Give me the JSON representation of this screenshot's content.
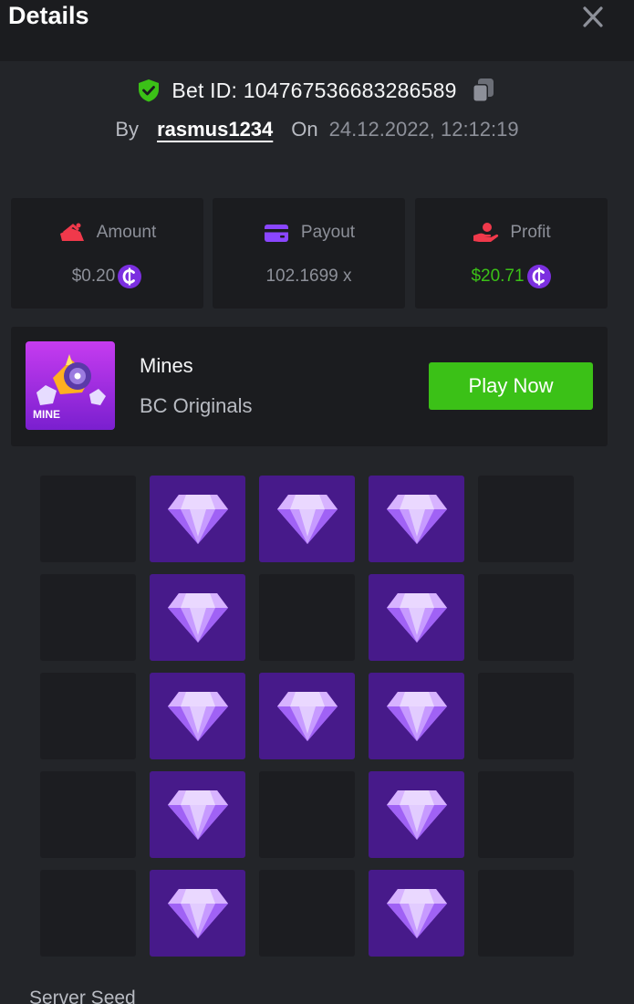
{
  "header": {
    "title": "Details",
    "close_icon": "close-icon"
  },
  "bet": {
    "bet_id_text": "Bet ID: 104767536683286589",
    "by_label": "By",
    "username": "rasmus1234",
    "on_label": "On",
    "datetime": "24.12.2022, 12:12:19",
    "icons": [
      "shield-check-icon",
      "copy-icon"
    ]
  },
  "stats": {
    "amount": {
      "label": "Amount",
      "value": "$0.20",
      "icon": "amount-icon",
      "coin_icon": "bc-coin-icon"
    },
    "payout": {
      "label": "Payout",
      "value": "102.1699 x",
      "icon": "wallet-card-icon"
    },
    "profit": {
      "label": "Profit",
      "value": "$20.71",
      "icon": "profit-hand-icon",
      "coin_icon": "bc-coin-icon"
    }
  },
  "game": {
    "thumbnail_text": "MINE",
    "name": "Mines",
    "provider": "BC Originals",
    "play_label": "Play Now"
  },
  "board": {
    "rows": 5,
    "cols": 5,
    "cells": [
      [
        "empty",
        "gem",
        "gem",
        "gem",
        "empty"
      ],
      [
        "empty",
        "gem",
        "empty",
        "gem",
        "empty"
      ],
      [
        "empty",
        "gem",
        "gem",
        "gem",
        "empty"
      ],
      [
        "empty",
        "gem",
        "empty",
        "gem",
        "empty"
      ],
      [
        "empty",
        "gem",
        "empty",
        "gem",
        "empty"
      ]
    ],
    "gem_icon": "diamond-icon"
  },
  "seed": {
    "server_seed_label": "Server Seed"
  },
  "colors": {
    "background": "#232529",
    "panel": "#1b1c1f",
    "accent_green": "#3bc117",
    "gem_tile": "#471a8a",
    "coin_purple": "#7b2fe0",
    "icon_red": "#f0394b"
  }
}
